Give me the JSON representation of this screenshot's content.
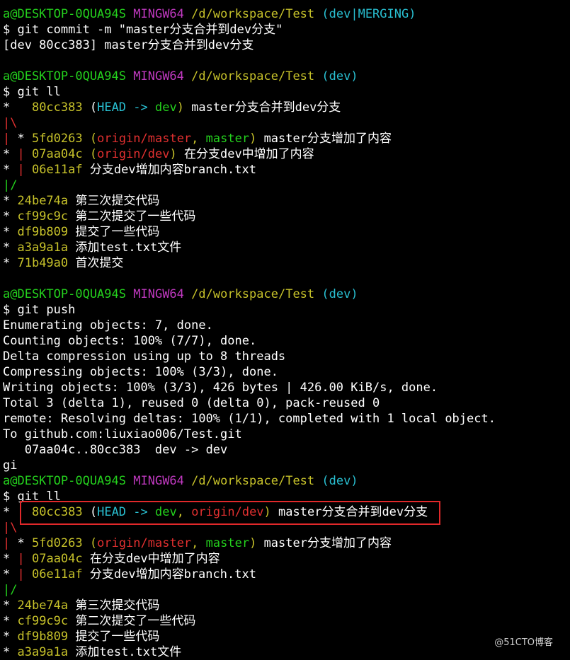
{
  "colors": {
    "user": "#24d11d",
    "mingw": "#c039c0",
    "path": "#c7c22a",
    "branch": "#29bfd1",
    "remote": "#e23030",
    "highlight": "#e0282a"
  },
  "lines": [
    [
      {
        "t": "a@DESKTOP-0QUA94S",
        "c": "green"
      },
      {
        "t": " "
      },
      {
        "t": "MINGW64",
        "c": "magenta"
      },
      {
        "t": " "
      },
      {
        "t": "/d/workspace/Test",
        "c": "yellow"
      },
      {
        "t": " "
      },
      {
        "t": "(dev|MERGING)",
        "c": "cyan"
      }
    ],
    [
      {
        "t": "$ git commit -m \"master分支合并到dev分支\""
      }
    ],
    [
      {
        "t": "[dev 80cc383] master分支合并到dev分支"
      }
    ],
    [
      {
        "t": ""
      }
    ],
    [
      {
        "t": "a@DESKTOP-0QUA94S",
        "c": "green"
      },
      {
        "t": " "
      },
      {
        "t": "MINGW64",
        "c": "magenta"
      },
      {
        "t": " "
      },
      {
        "t": "/d/workspace/Test",
        "c": "yellow"
      },
      {
        "t": " "
      },
      {
        "t": "(dev)",
        "c": "cyan"
      }
    ],
    [
      {
        "t": "$ git ll"
      }
    ],
    [
      {
        "t": "*   "
      },
      {
        "t": "80cc383",
        "c": "yellow"
      },
      {
        "t": " ("
      },
      {
        "t": "HEAD -> ",
        "c": "cyan"
      },
      {
        "t": "dev",
        "c": "green"
      },
      {
        "t": ")",
        "c": "yellow"
      },
      {
        "t": " master分支合并到dev分支"
      }
    ],
    [
      {
        "t": "|\\",
        "c": "remote"
      }
    ],
    [
      {
        "t": "|",
        "c": "remote"
      },
      {
        "t": " * "
      },
      {
        "t": "5fd0263",
        "c": "yellow"
      },
      {
        "t": " (",
        "c": "yellow"
      },
      {
        "t": "origin/master",
        "c": "remote"
      },
      {
        "t": ", ",
        "c": "yellow"
      },
      {
        "t": "master",
        "c": "green"
      },
      {
        "t": ")",
        "c": "yellow"
      },
      {
        "t": " master分支增加了内容"
      }
    ],
    [
      {
        "t": "* "
      },
      {
        "t": "|",
        "c": "remote"
      },
      {
        "t": " "
      },
      {
        "t": "07aa04c",
        "c": "yellow"
      },
      {
        "t": " (",
        "c": "yellow"
      },
      {
        "t": "origin/dev",
        "c": "remote"
      },
      {
        "t": ")",
        "c": "yellow"
      },
      {
        "t": " 在分支dev中增加了内容"
      }
    ],
    [
      {
        "t": "* "
      },
      {
        "t": "|",
        "c": "remote"
      },
      {
        "t": " "
      },
      {
        "t": "06e11af",
        "c": "yellow"
      },
      {
        "t": " 分支dev增加内容branch.txt"
      }
    ],
    [
      {
        "t": "|/",
        "c": "green"
      }
    ],
    [
      {
        "t": "* "
      },
      {
        "t": "24be74a",
        "c": "yellow"
      },
      {
        "t": " 第三次提交代码"
      }
    ],
    [
      {
        "t": "* "
      },
      {
        "t": "cf99c9c",
        "c": "yellow"
      },
      {
        "t": " 第二次提交了一些代码"
      }
    ],
    [
      {
        "t": "* "
      },
      {
        "t": "df9b809",
        "c": "yellow"
      },
      {
        "t": " 提交了一些代码"
      }
    ],
    [
      {
        "t": "* "
      },
      {
        "t": "a3a9a1a",
        "c": "yellow"
      },
      {
        "t": " 添加test.txt文件"
      }
    ],
    [
      {
        "t": "* "
      },
      {
        "t": "71b49a0",
        "c": "yellow"
      },
      {
        "t": " 首次提交"
      }
    ],
    [
      {
        "t": ""
      }
    ],
    [
      {
        "t": "a@DESKTOP-0QUA94S",
        "c": "green"
      },
      {
        "t": " "
      },
      {
        "t": "MINGW64",
        "c": "magenta"
      },
      {
        "t": " "
      },
      {
        "t": "/d/workspace/Test",
        "c": "yellow"
      },
      {
        "t": " "
      },
      {
        "t": "(dev)",
        "c": "cyan"
      }
    ],
    [
      {
        "t": "$ git push"
      }
    ],
    [
      {
        "t": "Enumerating objects: 7, done."
      }
    ],
    [
      {
        "t": "Counting objects: 100% (7/7), done."
      }
    ],
    [
      {
        "t": "Delta compression using up to 8 threads"
      }
    ],
    [
      {
        "t": "Compressing objects: 100% (3/3), done."
      }
    ],
    [
      {
        "t": "Writing objects: 100% (3/3), 426 bytes | 426.00 KiB/s, done."
      }
    ],
    [
      {
        "t": "Total 3 (delta 1), reused 0 (delta 0), pack-reused 0"
      }
    ],
    [
      {
        "t": "remote: Resolving deltas: 100% (1/1), completed with 1 local object."
      }
    ],
    [
      {
        "t": "To github.com:liuxiao006/Test.git"
      }
    ],
    [
      {
        "t": "   07aa04c..80cc383  dev -> dev"
      }
    ],
    [
      {
        "t": "gi"
      }
    ],
    [
      {
        "t": "a@DESKTOP-0QUA94S",
        "c": "green"
      },
      {
        "t": " "
      },
      {
        "t": "MINGW64",
        "c": "magenta"
      },
      {
        "t": " "
      },
      {
        "t": "/d/workspace/Test",
        "c": "yellow"
      },
      {
        "t": " "
      },
      {
        "t": "(dev)",
        "c": "cyan"
      }
    ],
    [
      {
        "t": "$ git ll"
      }
    ],
    [
      {
        "t": "*   "
      },
      {
        "t": "80cc383",
        "c": "yellow"
      },
      {
        "t": " ("
      },
      {
        "t": "HEAD -> ",
        "c": "cyan"
      },
      {
        "t": "dev",
        "c": "green"
      },
      {
        "t": ", ",
        "c": "yellow"
      },
      {
        "t": "origin/dev",
        "c": "remote"
      },
      {
        "t": ")",
        "c": "yellow"
      },
      {
        "t": " master分支合并到dev分支"
      }
    ],
    [
      {
        "t": "|\\",
        "c": "remote"
      }
    ],
    [
      {
        "t": "|",
        "c": "remote"
      },
      {
        "t": " * "
      },
      {
        "t": "5fd0263",
        "c": "yellow"
      },
      {
        "t": " (",
        "c": "yellow"
      },
      {
        "t": "origin/master",
        "c": "remote"
      },
      {
        "t": ", ",
        "c": "yellow"
      },
      {
        "t": "master",
        "c": "green"
      },
      {
        "t": ")",
        "c": "yellow"
      },
      {
        "t": " master分支增加了内容"
      }
    ],
    [
      {
        "t": "* "
      },
      {
        "t": "|",
        "c": "remote"
      },
      {
        "t": " "
      },
      {
        "t": "07aa04c",
        "c": "yellow"
      },
      {
        "t": " 在分支dev中增加了内容"
      }
    ],
    [
      {
        "t": "* "
      },
      {
        "t": "|",
        "c": "remote"
      },
      {
        "t": " "
      },
      {
        "t": "06e11af",
        "c": "yellow"
      },
      {
        "t": " 分支dev增加内容branch.txt"
      }
    ],
    [
      {
        "t": "|/",
        "c": "green"
      }
    ],
    [
      {
        "t": "* "
      },
      {
        "t": "24be74a",
        "c": "yellow"
      },
      {
        "t": " 第三次提交代码"
      }
    ],
    [
      {
        "t": "* "
      },
      {
        "t": "cf99c9c",
        "c": "yellow"
      },
      {
        "t": " 第二次提交了一些代码"
      }
    ],
    [
      {
        "t": "* "
      },
      {
        "t": "df9b809",
        "c": "yellow"
      },
      {
        "t": " 提交了一些代码"
      }
    ],
    [
      {
        "t": "* "
      },
      {
        "t": "a3a9a1a",
        "c": "yellow"
      },
      {
        "t": " 添加test.txt文件"
      }
    ]
  ],
  "watermark": "@51CTO博客"
}
